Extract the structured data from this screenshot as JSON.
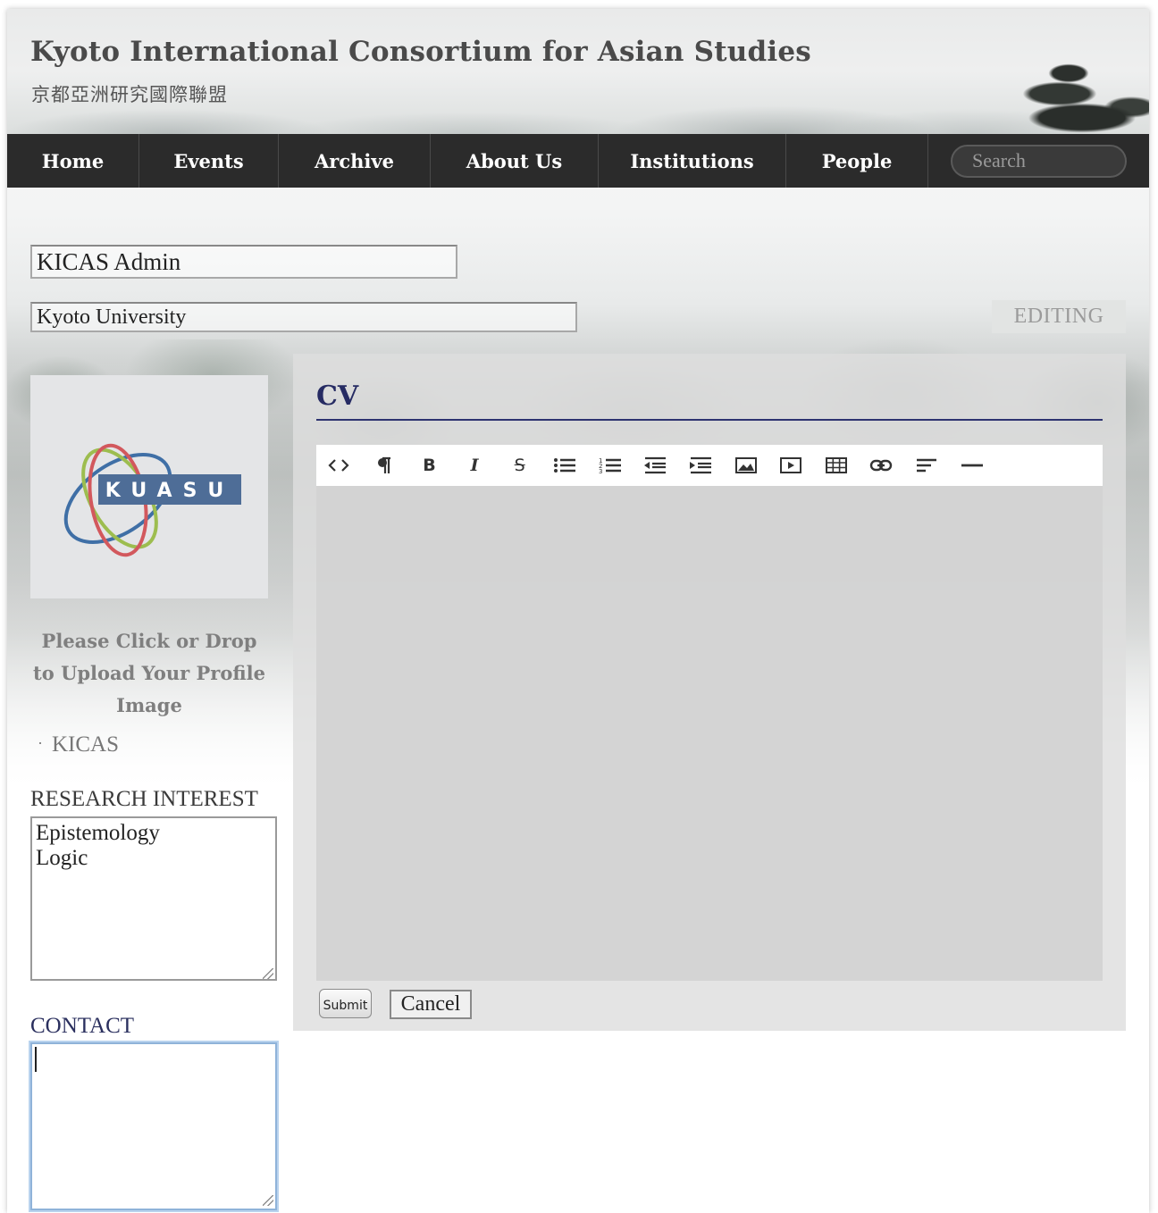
{
  "header": {
    "title": "Kyoto International Consortium for Asian Studies",
    "subtitle": "京都亞洲研究國際聯盟"
  },
  "nav": {
    "items": [
      {
        "label": "Home"
      },
      {
        "label": "Events"
      },
      {
        "label": "Archive"
      },
      {
        "label": "About Us"
      },
      {
        "label": "Institutions"
      },
      {
        "label": "People"
      }
    ],
    "search_placeholder": "Search"
  },
  "profile": {
    "name": "KICAS Admin",
    "institution": "Kyoto University",
    "status_badge": "EDITING",
    "logo_text": "KUASU",
    "upload_hint": "Please Click or Drop to Upload Your Profile Image",
    "groups": [
      "KICAS"
    ],
    "research_label": "RESEARCH INTEREST",
    "research_interest": "Epistemology\nLogic",
    "contact_label": "CONTACT",
    "contact_value": ""
  },
  "cv": {
    "title": "CV",
    "toolbar": [
      {
        "icon": "code-view-icon"
      },
      {
        "icon": "paragraph-icon"
      },
      {
        "icon": "bold-icon",
        "glyph": "B"
      },
      {
        "icon": "italic-icon",
        "glyph": "I"
      },
      {
        "icon": "strikethrough-icon",
        "glyph": "S"
      },
      {
        "icon": "unordered-list-icon"
      },
      {
        "icon": "ordered-list-icon"
      },
      {
        "icon": "outdent-icon"
      },
      {
        "icon": "indent-icon"
      },
      {
        "icon": "image-icon"
      },
      {
        "icon": "video-icon"
      },
      {
        "icon": "table-icon"
      },
      {
        "icon": "link-icon"
      },
      {
        "icon": "align-left-icon"
      },
      {
        "icon": "horizontal-rule-icon"
      }
    ],
    "submit_label": "Submit",
    "cancel_label": "Cancel"
  },
  "colors": {
    "nav_bg": "#2b2b2b",
    "accent_navy": "#262b63",
    "focus_blue": "#8fb3d9"
  }
}
